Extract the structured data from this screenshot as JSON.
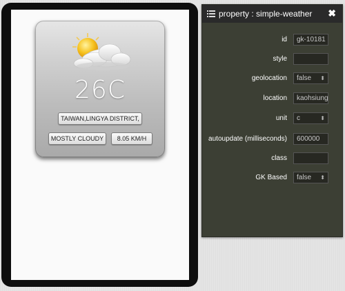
{
  "weather": {
    "temperature": "26C",
    "location": "TAIWAN,LINGYA DISTRICT,",
    "condition": "MOSTLY CLOUDY",
    "wind": "8.05 KM/H",
    "icon": "partly-cloudy-sun-icon"
  },
  "panel": {
    "title": "property : simple-weather",
    "close_label": "✖",
    "rows": [
      {
        "label": "id",
        "value": "gk-10181",
        "type": "input"
      },
      {
        "label": "style",
        "value": "",
        "type": "input"
      },
      {
        "label": "geolocation",
        "value": "false",
        "type": "select"
      },
      {
        "label": "location",
        "value": "kaohsiung",
        "type": "input"
      },
      {
        "label": "unit",
        "value": "c",
        "type": "select"
      },
      {
        "label": "autoupdate (milliseconds)",
        "value": "600000",
        "type": "input"
      },
      {
        "label": "class",
        "value": "",
        "type": "input"
      },
      {
        "label": "GK Based",
        "value": "false",
        "type": "select"
      }
    ]
  },
  "colors": {
    "panel_bg": "#3c3f34",
    "panel_header_bg": "#2a2a2a",
    "device_frame": "#0d0d0d"
  }
}
